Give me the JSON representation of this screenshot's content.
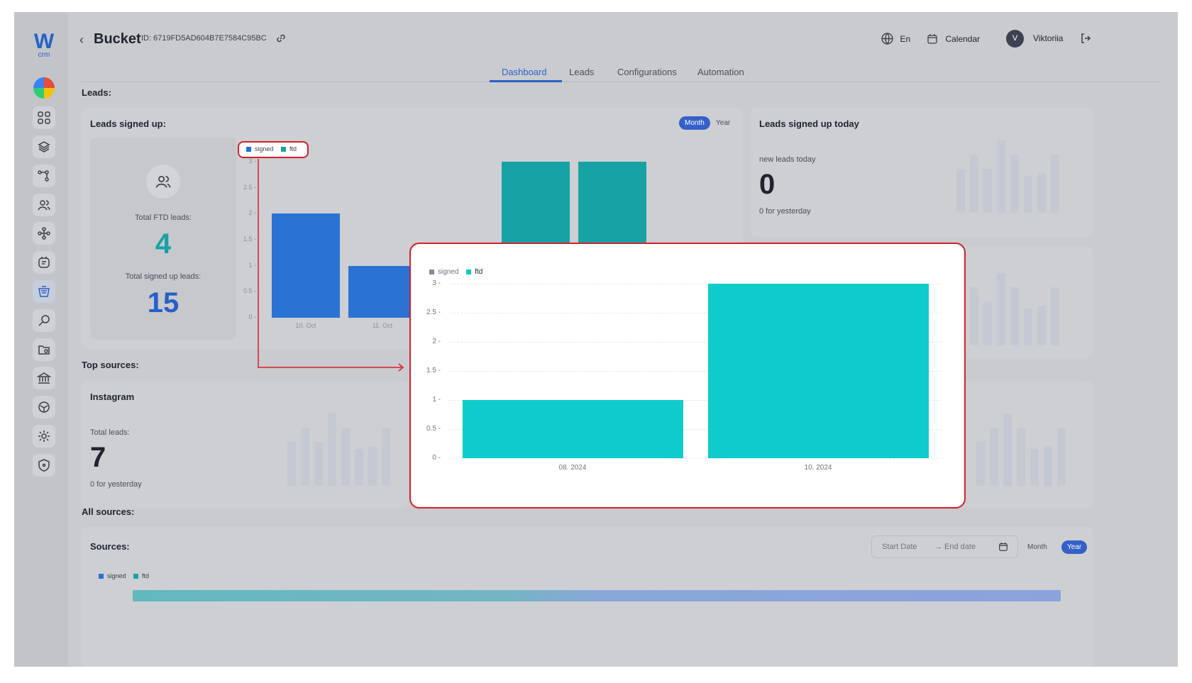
{
  "header": {
    "back_icon": "chevron-left-icon",
    "title": "Bucket",
    "id_text": "ID: 6719FD5AD604B7E7584C95BC",
    "language": "En",
    "calendar": "Calendar",
    "avatar_initial": "V",
    "user_name": "Viktoriia"
  },
  "logo": {
    "mark": "W",
    "sub": "crm"
  },
  "tabs": [
    {
      "label": "Dashboard"
    },
    {
      "label": "Leads"
    },
    {
      "label": "Configurations"
    },
    {
      "label": "Automation"
    }
  ],
  "sections": {
    "leads": "Leads:",
    "top_sources": "Top sources:",
    "all_sources": "All sources:"
  },
  "signed_card": {
    "title": "Leads signed up:",
    "period_month": "Month",
    "period_year": "Year",
    "total_ftd_label": "Total FTD leads:",
    "total_ftd_value": "4",
    "total_signed_label": "Total signed up leads:",
    "total_signed_value": "15",
    "legend": [
      "signed",
      "ftd"
    ]
  },
  "today_card": {
    "title": "Leads signed up today",
    "label": "new leads today",
    "value": "0",
    "sub": "0 for yesterday"
  },
  "instagram_card": {
    "title": "Instagram",
    "label": "Total leads:",
    "value": "7",
    "sub": "0 for yesterday"
  },
  "sources_card": {
    "title": "Sources:",
    "start_placeholder": "Start Date",
    "end_placeholder": "→ End date",
    "period_month": "Month",
    "period_year": "Year",
    "legend": [
      "signed",
      "ftd"
    ]
  },
  "colors": {
    "accent": "#2f5fc7",
    "signed": "#2a72d4",
    "ftd": "#17a3a5",
    "popup_ftd": "#0ecccc",
    "highlight": "#d81e2c"
  },
  "chart_data": [
    {
      "type": "bar",
      "stacked": true,
      "categories": [
        "10. Oct",
        "11. Oct",
        "",
        "",
        "",
        ""
      ],
      "series": [
        {
          "name": "signed",
          "values": [
            2,
            1,
            null,
            0,
            1,
            1
          ]
        },
        {
          "name": "ftd",
          "values": [
            0,
            0,
            null,
            3,
            2,
            0
          ]
        }
      ],
      "ylim": [
        0,
        3
      ],
      "yticks": [
        "0",
        "0.5",
        "1",
        "1.5",
        "2",
        "2.5",
        "3"
      ]
    },
    {
      "type": "bar",
      "categories": [
        "08. 2024",
        "10. 2024"
      ],
      "series": [
        {
          "name": "signed",
          "values": [
            0,
            0
          ]
        },
        {
          "name": "ftd",
          "values": [
            1,
            3
          ]
        }
      ],
      "ylim": [
        0,
        3
      ],
      "yticks": [
        "0",
        "0.5",
        "1",
        "1.5",
        "2",
        "2.5",
        "3"
      ],
      "legend": [
        "signed",
        "ftd"
      ]
    }
  ]
}
